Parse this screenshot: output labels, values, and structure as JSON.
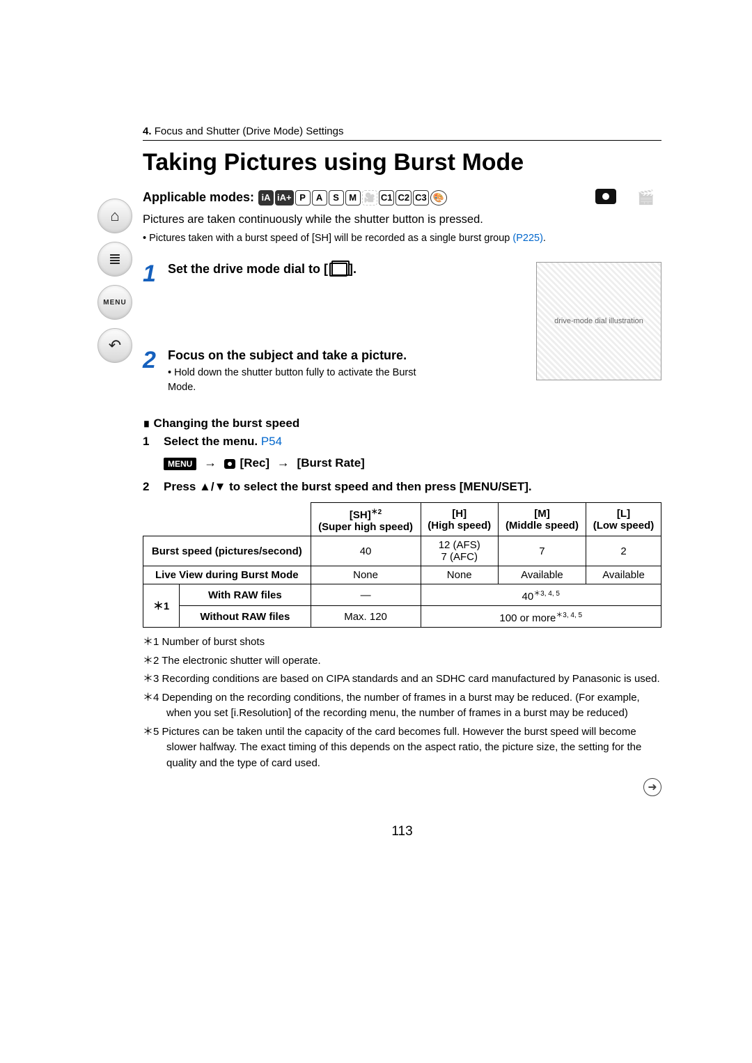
{
  "breadcrumb": {
    "num": "4.",
    "text": "Focus and Shutter (Drive Mode) Settings"
  },
  "title": "Taking Pictures using Burst Mode",
  "applicable_modes_label": "Applicable modes:",
  "modes": [
    "iA",
    "iA+",
    "P",
    "A",
    "S",
    "M",
    "🎥",
    "C1",
    "C2",
    "C3",
    "🎨"
  ],
  "intro": "Pictures are taken continuously while the shutter button is pressed.",
  "intro_bullet_prefix": "Pictures taken with a burst speed of [SH] will be recorded as a single burst group ",
  "intro_bullet_link": "(P225)",
  "intro_bullet_suffix": ".",
  "steps": [
    {
      "title_pre": "Set the drive mode dial to [",
      "title_post": "]."
    },
    {
      "title": "Focus on the subject and take a picture.",
      "bullet": "Hold down the shutter button fully to activate the Burst Mode."
    }
  ],
  "changing_title": "Changing the burst speed",
  "sub1_label": "1",
  "sub1_text_pre": "Select the menu. ",
  "sub1_link": "P54",
  "menu_badge": "MENU",
  "menu_path_rec": "[Rec]",
  "menu_path_arrow": "→",
  "menu_path_burst": "[Burst Rate]",
  "sub2_label": "2",
  "sub2_text": "Press ▲/▼ to select the burst speed and then press [MENU/SET].",
  "table": {
    "headers": [
      {
        "code": "[SH]",
        "sup": "＊2",
        "desc": "(Super high speed)"
      },
      {
        "code": "[H]",
        "desc": "(High speed)"
      },
      {
        "code": "[M]",
        "desc": "(Middle speed)"
      },
      {
        "code": "[L]",
        "desc": "(Low speed)"
      }
    ],
    "rows": {
      "burst_speed_label": "Burst speed (pictures/second)",
      "burst_speed_vals": [
        "40",
        "12 (AFS)\n7 (AFC)",
        "7",
        "2"
      ],
      "live_view_label": "Live View during Burst Mode",
      "live_view_vals": [
        "None",
        "None",
        "Available",
        "Available"
      ],
      "star1": "＊1",
      "with_raw_label": "With RAW files",
      "with_raw_vals": [
        "—",
        "40"
      ],
      "with_raw_sup": "＊3, 4, 5",
      "without_raw_label": "Without RAW files",
      "without_raw_val1": "Max. 120",
      "without_raw_val2": "100 or more",
      "without_raw_sup": "＊3, 4, 5"
    }
  },
  "footnotes": [
    "＊1 Number of burst shots",
    "＊2 The electronic shutter will operate.",
    "＊3 Recording conditions are based on CIPA standards and an SDHC card manufactured by Panasonic is used.",
    "＊4 Depending on the recording conditions, the number of frames in a burst may be reduced. (For example, when you set [i.Resolution] of the recording menu, the number of frames in a burst may be reduced)",
    "＊5 Pictures can be taken until the capacity of the card becomes full. However the burst speed will become slower halfway. The exact timing of this depends on the aspect ratio, the picture size, the setting for the quality and the type of card used."
  ],
  "page_number": "113",
  "sidebar": {
    "home": "⌂",
    "list": "≣",
    "menu": "MENU",
    "back": "↶"
  }
}
